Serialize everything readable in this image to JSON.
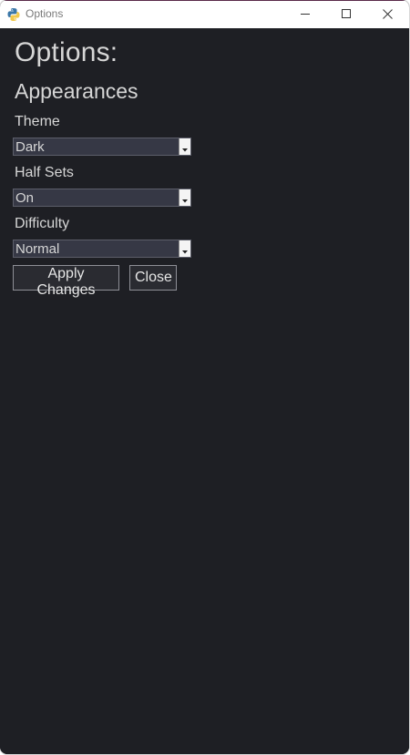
{
  "window": {
    "title": "Options"
  },
  "page": {
    "heading": "Options:",
    "section": "Appearances"
  },
  "settings": [
    {
      "label": "Theme",
      "value": "Dark"
    },
    {
      "label": "Half Sets",
      "value": "On"
    },
    {
      "label": "Difficulty",
      "value": "Normal"
    }
  ],
  "buttons": {
    "apply": "Apply Changes",
    "close": "Close"
  },
  "icons": {
    "app": "python-icon",
    "minimize": "minimize-icon",
    "maximize": "maximize-icon",
    "close": "close-icon",
    "dropdown": "dropdown-arrow-icon"
  },
  "colors": {
    "background": "#1e1f24",
    "field": "#363845",
    "text": "#d6d6d6"
  }
}
